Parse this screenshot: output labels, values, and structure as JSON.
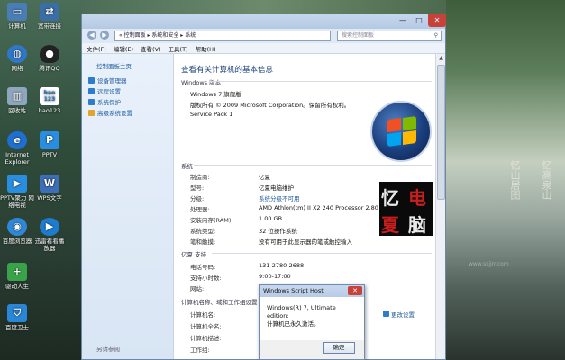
{
  "desktop": {
    "icons": [
      {
        "label": "计算机"
      },
      {
        "label": "宽带连接"
      },
      {
        "label": "网络"
      },
      {
        "label": "腾讯QQ"
      },
      {
        "label": "回收站"
      },
      {
        "label": "hao123",
        "badge": "hao 123"
      },
      {
        "label": "Internet Explorer"
      },
      {
        "label": "PPTV"
      },
      {
        "label": "PPTV聚力 网络电视"
      },
      {
        "label": "WPS文字"
      },
      {
        "label": "百度浏览器"
      },
      {
        "label": "迅雷看看播放器"
      },
      {
        "label": "驱动人生"
      },
      {
        "label": "百度卫士"
      }
    ],
    "wallpaper_text": [
      "忆",
      "山",
      "居",
      "图",
      "忆",
      "高",
      "泉",
      "山"
    ],
    "wallpaper_caption": "www.ssjjrr.com"
  },
  "window": {
    "controls": {
      "minimize": "—",
      "maximize": "□",
      "close": "✕"
    },
    "nav": {
      "back": "◀",
      "forward": "▶"
    },
    "address": "« 控制面板 ▸ 系统和安全 ▸ 系统",
    "search_placeholder": "搜索控制面板",
    "menu": [
      "文件(F)",
      "编辑(E)",
      "查看(V)",
      "工具(T)",
      "帮助(H)"
    ],
    "sidebar": {
      "home": "控制面板主页",
      "links": [
        "设备管理器",
        "远程设置",
        "系统保护",
        "高级系统设置"
      ],
      "see_also": "另请参阅",
      "colors": [
        "#2f7bd0",
        "#2f7bd0",
        "#2f7bd0",
        "#e2a52a"
      ]
    },
    "main": {
      "heading": "查看有关计算机的基本信息",
      "windows_edition": {
        "title": "Windows 版本",
        "edition": "Windows 7 旗舰版",
        "copyright": "版权所有 © 2009 Microsoft Corporation。保留所有权利。",
        "service_pack": "Service Pack 1"
      },
      "system": {
        "title": "系统",
        "rows": [
          {
            "label": "制造商:",
            "value": "亿夏"
          },
          {
            "label": "型号:",
            "value": "亿夏电脑维护"
          },
          {
            "label": "分级:",
            "value": "系统分级不可用",
            "link": true
          },
          {
            "label": "处理器:",
            "value": "AMD Athlon(tm) II X2 240 Processor   2.80 GHz"
          },
          {
            "label": "安装内存(RAM):",
            "value": "1.00 GB"
          },
          {
            "label": "系统类型:",
            "value": "32 位操作系统"
          },
          {
            "label": "笔和触摸:",
            "value": "没有可用于此显示器的笔或触控输入"
          }
        ],
        "oem_chars": [
          "忆",
          "电",
          "夏",
          "脑"
        ]
      },
      "support": {
        "title": "亿夏 支持",
        "rows": [
          {
            "label": "电话号码:",
            "value": "131-2780-2688"
          },
          {
            "label": "支持小时数:",
            "value": "9:00-17:00"
          },
          {
            "label": "网站:",
            "value": ""
          }
        ]
      },
      "computer_name": {
        "title": "计算机名称、域和工作组设置",
        "change": "更改设置",
        "rows": [
          {
            "label": "计算机名:"
          },
          {
            "label": "计算机全名:"
          },
          {
            "label": "计算机描述:"
          },
          {
            "label": "工作组:"
          }
        ]
      }
    }
  },
  "dialog": {
    "title": "Windows Script Host",
    "close": "✕",
    "message_line1": "Windows(R) 7, Ultimate edition:",
    "message_line2": "计算机已永久激活。",
    "ok": "确定"
  }
}
